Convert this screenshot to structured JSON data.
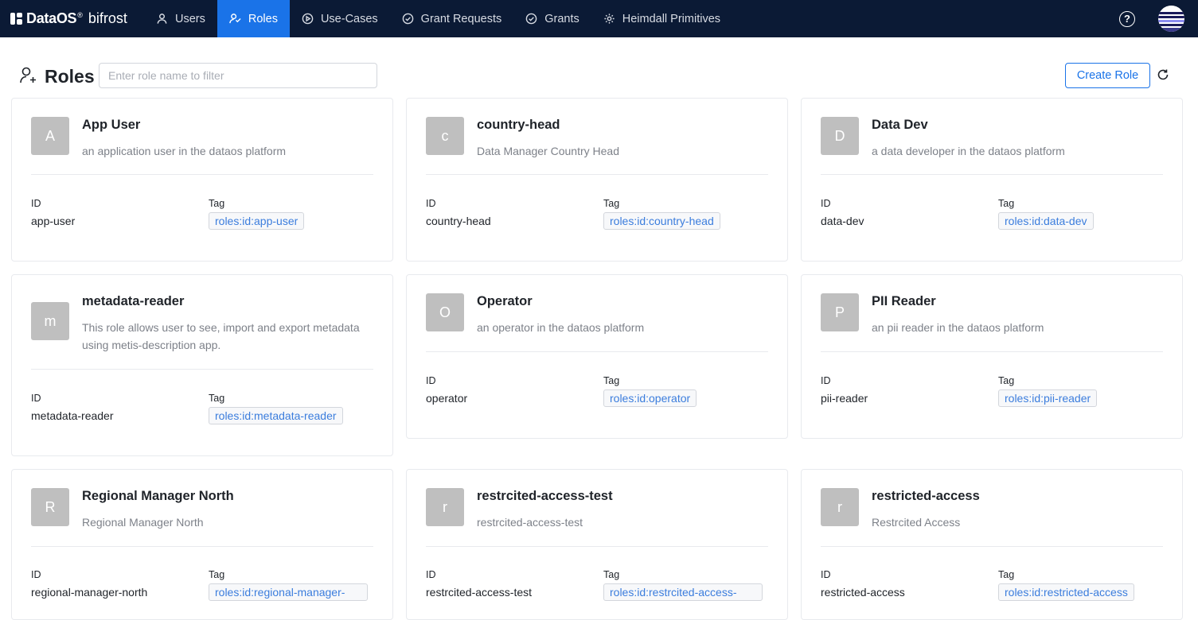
{
  "app": {
    "brand": "DataOS",
    "registered": "®",
    "product": "bifrost"
  },
  "nav": [
    {
      "label": "Users",
      "icon": "user-icon",
      "active": false
    },
    {
      "label": "Roles",
      "icon": "roles-icon",
      "active": true
    },
    {
      "label": "Use-Cases",
      "icon": "play-circle-icon",
      "active": false
    },
    {
      "label": "Grant Requests",
      "icon": "check-circle-icon",
      "active": false
    },
    {
      "label": "Grants",
      "icon": "check-circle-icon",
      "active": false
    },
    {
      "label": "Heimdall Primitives",
      "icon": "gear-icon",
      "active": false
    }
  ],
  "header": {
    "help": "?",
    "title": "Roles",
    "filter_placeholder": "Enter role name to filter",
    "filter_value": "",
    "create_label": "Create Role"
  },
  "labels": {
    "id": "ID",
    "tag": "Tag"
  },
  "roles": [
    {
      "initial": "A",
      "name": "App User",
      "description": "an application user in the dataos platform",
      "id": "app-user",
      "tag": "roles:id:app-user"
    },
    {
      "initial": "c",
      "name": "country-head",
      "description": "Data Manager Country Head",
      "id": "country-head",
      "tag": "roles:id:country-head"
    },
    {
      "initial": "D",
      "name": "Data Dev",
      "description": "a data developer in the dataos platform",
      "id": "data-dev",
      "tag": "roles:id:data-dev"
    },
    {
      "initial": "m",
      "name": "metadata-reader",
      "description": "This role allows user to see, import and export metadata using metis-description app.",
      "id": "metadata-reader",
      "tag": "roles:id:metadata-reader"
    },
    {
      "initial": "O",
      "name": "Operator",
      "description": "an operator in the dataos platform",
      "id": "operator",
      "tag": "roles:id:operator"
    },
    {
      "initial": "P",
      "name": "PII Reader",
      "description": "an pii reader in the dataos platform",
      "id": "pii-reader",
      "tag": "roles:id:pii-reader"
    },
    {
      "initial": "R",
      "name": "Regional Manager North",
      "description": "Regional Manager North",
      "id": "regional-manager-north",
      "tag": "roles:id:regional-manager-"
    },
    {
      "initial": "r",
      "name": "restrcited-access-test",
      "description": "restrcited-access-test",
      "id": "restrcited-access-test",
      "tag": "roles:id:restrcited-access-"
    },
    {
      "initial": "r",
      "name": "restricted-access",
      "description": "Restrcited Access",
      "id": "restricted-access",
      "tag": "roles:id:restricted-access"
    }
  ]
}
